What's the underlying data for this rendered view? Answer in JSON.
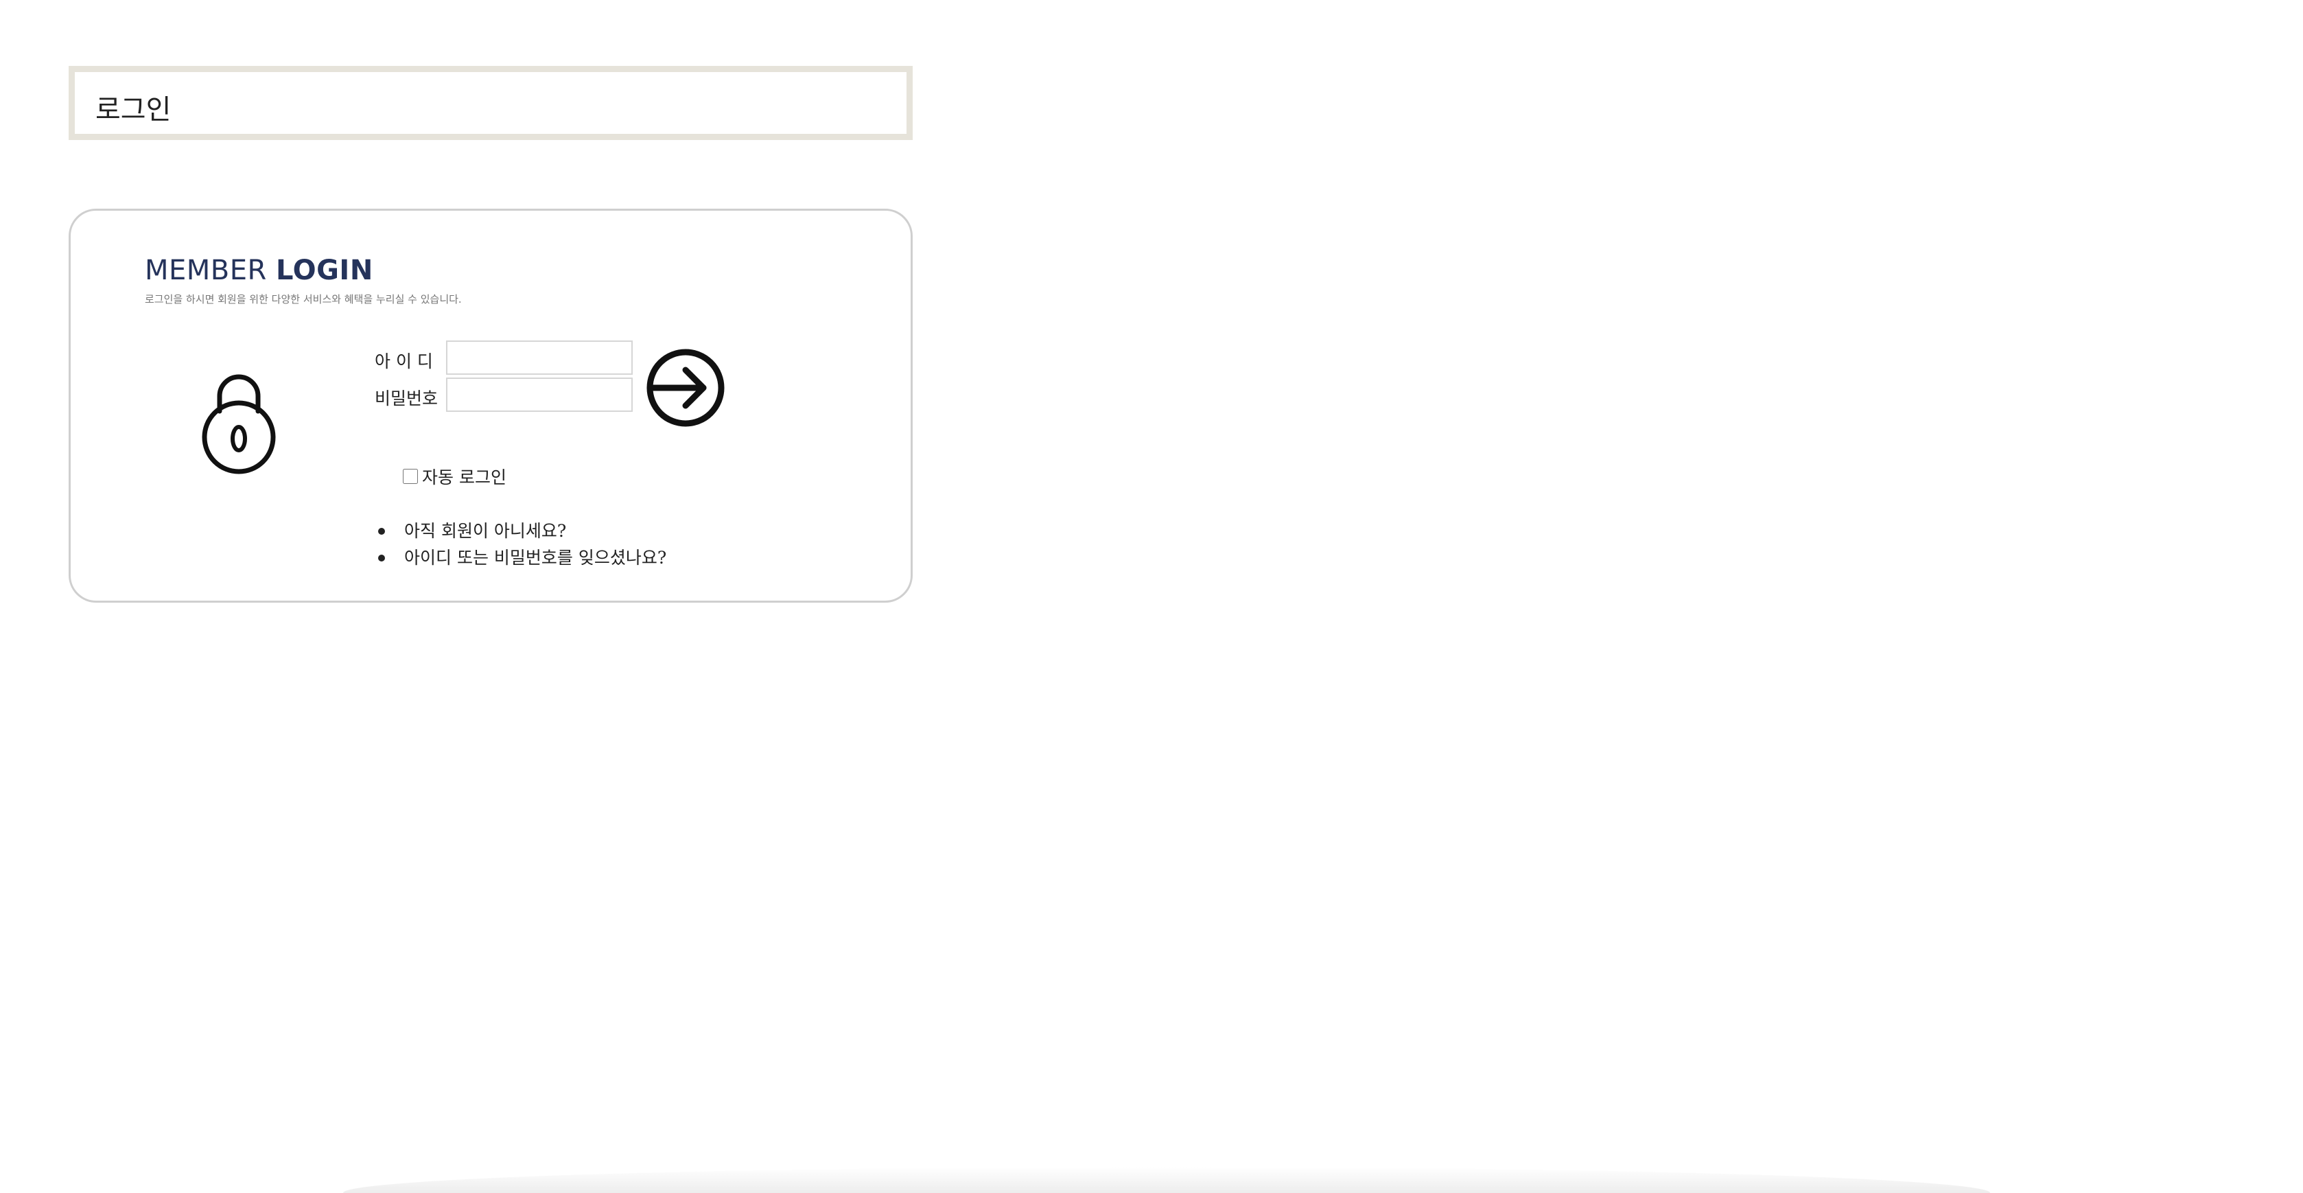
{
  "page": {
    "title": "로그인"
  },
  "login": {
    "heading_light": "MEMBER",
    "heading_bold": "LOGIN",
    "subtitle": "로그인을 하시면 회원을 위한 다양한 서비스와 혜택을 누리실 수 있습니다.",
    "id_label": "아 이 디",
    "id_value": "",
    "password_label": "비밀번호",
    "password_value": "",
    "auto_login_label": "자동 로그인",
    "auto_login_checked": false,
    "links": [
      "아직 회원이 아니세요?",
      "아이디 또는 비밀번호를 잊으셨나요?"
    ]
  },
  "icons": {
    "lock": "lock-icon",
    "submit": "login-arrow-icon"
  },
  "colors": {
    "heading": "#25335b",
    "title_border": "#e6e3da",
    "panel_border": "#cfcfcf"
  }
}
